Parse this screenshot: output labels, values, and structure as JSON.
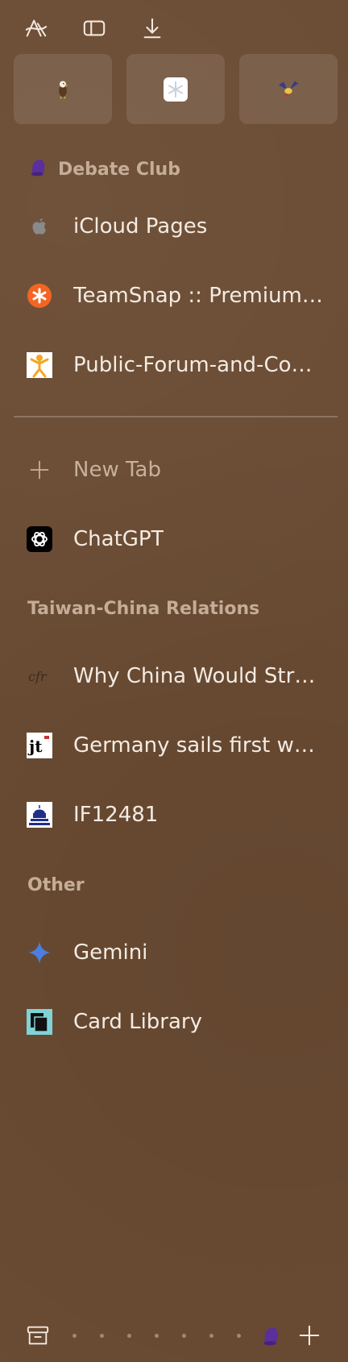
{
  "toolbar": {
    "icons": [
      "arc-logo-icon",
      "sidebar-toggle-icon",
      "download-icon"
    ]
  },
  "pinned": [
    {
      "name": "eagle-favicon"
    },
    {
      "name": "snowflake-favicon"
    },
    {
      "name": "bird-favicon"
    }
  ],
  "space": {
    "title": "Debate Club",
    "icon": "purple-bell-icon"
  },
  "pinned_tabs": [
    {
      "label": "iCloud Pages",
      "icon": "apple-icon"
    },
    {
      "label": "TeamSnap :: Premium P...",
      "icon": "teamsnap-icon"
    },
    {
      "label": "Public-Forum-and-Con...",
      "icon": "speaker-figure-icon"
    }
  ],
  "new_tab": {
    "label": "New Tab"
  },
  "tabs": [
    {
      "label": "ChatGPT",
      "icon": "openai-icon"
    }
  ],
  "folders": [
    {
      "title": "Taiwan-China Relations",
      "items": [
        {
          "label": "Why China Would Stru...",
          "icon": "cfr-icon"
        },
        {
          "label": "Germany sails first wars...",
          "icon": "jt-icon"
        },
        {
          "label": "IF12481",
          "icon": "capitol-icon"
        }
      ]
    },
    {
      "title": "Other",
      "items": [
        {
          "label": "Gemini",
          "icon": "gemini-sparkle-icon"
        },
        {
          "label": "Card Library",
          "icon": "card-library-icon"
        }
      ]
    }
  ],
  "colors": {
    "background": "#6a4b33",
    "text": "#f4ebe2",
    "muted": "#c5ad97",
    "accent_purple": "#5b2f9c"
  }
}
